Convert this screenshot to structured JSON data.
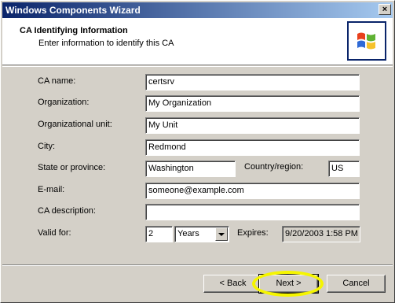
{
  "window": {
    "title": "Windows Components Wizard",
    "close_glyph": "×"
  },
  "header": {
    "title": "CA Identifying Information",
    "subtitle": "Enter information to identify this CA",
    "icon": "windows-logo-icon"
  },
  "form": {
    "ca_name": {
      "label": "CA name:",
      "value": "certsrv"
    },
    "organization": {
      "label": "Organization:",
      "value": "My Organization"
    },
    "org_unit": {
      "label": "Organizational unit:",
      "value": "My Unit"
    },
    "city": {
      "label": "City:",
      "value": "Redmond"
    },
    "state": {
      "label": "State or province:",
      "value": "Washington"
    },
    "country": {
      "label": "Country/region:",
      "value": "US"
    },
    "email": {
      "label": "E-mail:",
      "value": "someone@example.com"
    },
    "description": {
      "label": "CA description:",
      "value": ""
    },
    "valid_for": {
      "label": "Valid for:",
      "value": "2",
      "unit": "Years"
    },
    "expires": {
      "label": "Expires:",
      "value": "9/20/2003 1:58 PM"
    }
  },
  "buttons": {
    "back": "< Back",
    "next": "Next >",
    "cancel": "Cancel"
  },
  "colors": {
    "title_start": "#0a246a",
    "title_end": "#a6caf0",
    "face": "#d4d0c8",
    "highlight": "#f5f500"
  }
}
